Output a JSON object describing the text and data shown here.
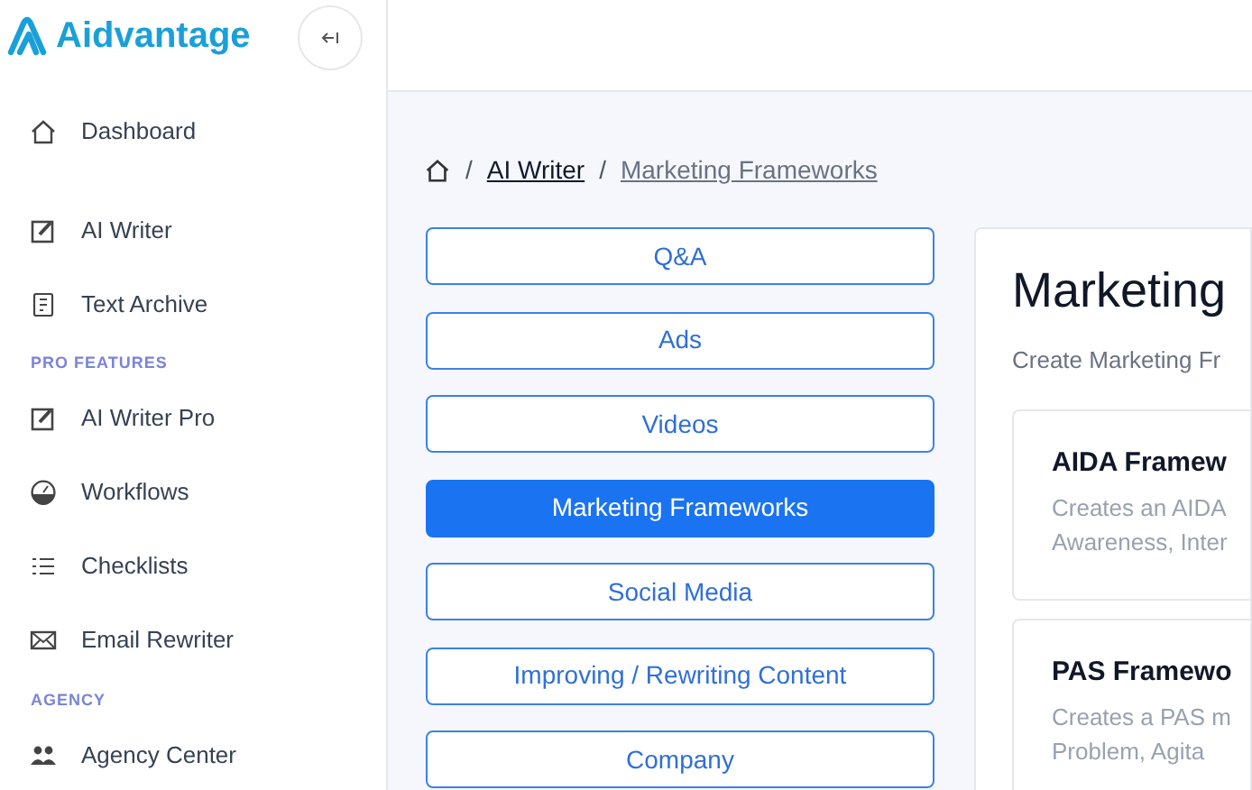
{
  "brand": {
    "name": "Aidvantage"
  },
  "sidebar": {
    "items": [
      {
        "kind": "link",
        "label": "Dashboard"
      },
      {
        "kind": "gap"
      },
      {
        "kind": "link",
        "label": "AI Writer"
      },
      {
        "kind": "link",
        "label": "Text Archive"
      },
      {
        "kind": "section",
        "label": "PRO FEATURES"
      },
      {
        "kind": "link",
        "label": "AI Writer Pro"
      },
      {
        "kind": "link",
        "label": "Workflows"
      },
      {
        "kind": "link",
        "label": "Checklists"
      },
      {
        "kind": "link",
        "label": "Email Rewriter"
      },
      {
        "kind": "section",
        "label": "AGENCY"
      },
      {
        "kind": "link",
        "label": "Agency Center"
      }
    ]
  },
  "breadcrumb": [
    {
      "kind": "sep",
      "text": "/"
    },
    {
      "kind": "link",
      "text": "AI Writer"
    },
    {
      "kind": "sep",
      "text": "/"
    },
    {
      "kind": "current",
      "text": "Marketing Frameworks"
    }
  ],
  "categories": [
    {
      "label": "Q&A",
      "selected": false
    },
    {
      "label": "Ads",
      "selected": false
    },
    {
      "label": "Videos",
      "selected": false
    },
    {
      "label": "Marketing Frameworks",
      "selected": true
    },
    {
      "label": "Social Media",
      "selected": false
    },
    {
      "label": "Improving / Rewriting Content",
      "selected": false
    },
    {
      "label": "Company",
      "selected": false
    }
  ],
  "panel": {
    "title": "Marketing",
    "subtitle": "Create Marketing Fr",
    "cards": [
      {
        "title": "AIDA Framew",
        "description": [
          "Creates an AIDA",
          "Awareness, Inter"
        ]
      },
      {
        "title": "PAS Framewo",
        "description": [
          "Creates a PAS m",
          "Problem, Agita"
        ]
      }
    ]
  }
}
